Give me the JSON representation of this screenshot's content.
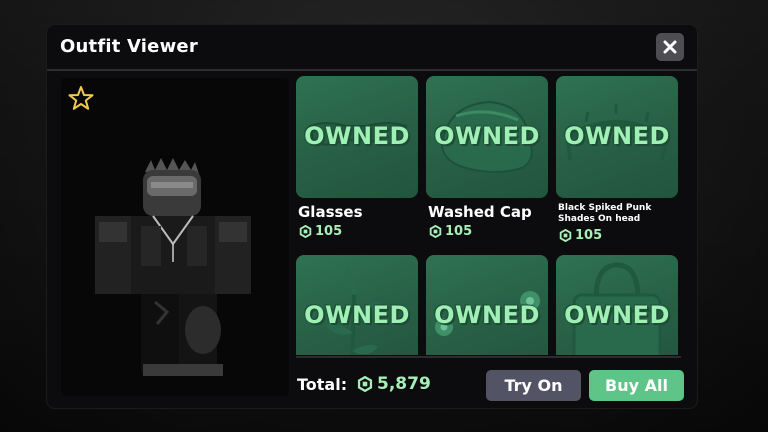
{
  "modal": {
    "title": "Outfit Viewer"
  },
  "items": [
    {
      "name": "Glasses",
      "price": "105",
      "status": "OWNED",
      "icon": "glasses"
    },
    {
      "name": "Washed Cap",
      "price": "105",
      "status": "OWNED",
      "icon": "cap"
    },
    {
      "name": "Black Spiked Punk Shades On head",
      "price": "105",
      "status": "OWNED",
      "icon": "spiked-shades"
    },
    {
      "name": "",
      "price": "",
      "status": "OWNED",
      "icon": "plant"
    },
    {
      "name": "",
      "price": "",
      "status": "OWNED",
      "icon": "orbs"
    },
    {
      "name": "",
      "price": "",
      "status": "OWNED",
      "icon": "bag"
    }
  ],
  "footer": {
    "total_label": "Total:",
    "total_value": "5,879",
    "try_on_label": "Try On",
    "buy_all_label": "Buy All"
  },
  "colors": {
    "accent_green": "#5fc487",
    "card_green": "#2f7252",
    "price_green": "#a6f0b8",
    "try_on_bg": "#535366"
  }
}
